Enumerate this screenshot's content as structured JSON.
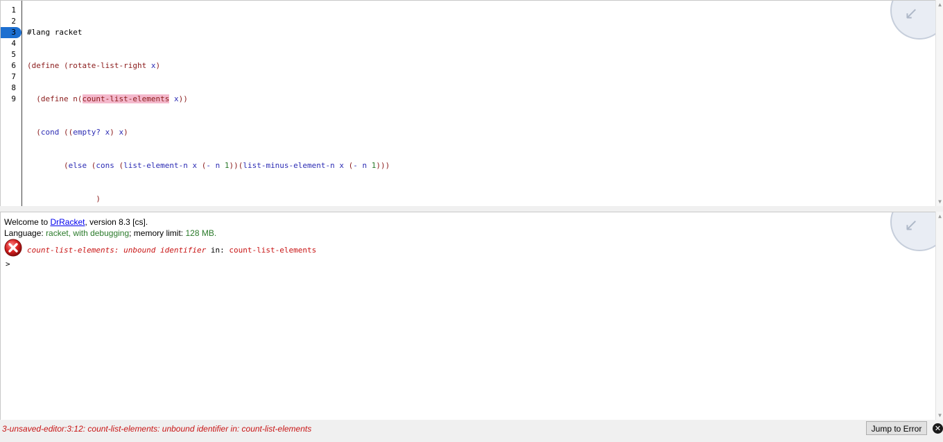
{
  "definitions": {
    "line_numbers": [
      "1",
      "2",
      "3",
      "4",
      "5",
      "6",
      "7",
      "8",
      "9"
    ],
    "current_line": "3",
    "code": {
      "l1": "#lang racket",
      "l2_open": "(",
      "l2_kw": "define",
      "l2_rest_open": " (",
      "l2_name": "rotate-list-right",
      "l2_arg": " x",
      "l2_close": ")",
      "l3_indent": "  ",
      "l3_open": "(",
      "l3_kw": "define",
      "l3_name": " n",
      "l3_p": "(",
      "l3_err": "count-list-elements",
      "l3_arg": " x",
      "l3_close": "))",
      "l4_indent": "  ",
      "l4_open": "(",
      "l4_kw": "cond",
      "l4_sp": " ",
      "l4_p1": "((",
      "l4_f": "empty?",
      "l4_arg": " x",
      "l4_p2": ")",
      "l4_val": " x",
      "l4_p3": ")",
      "l5_indent": "        ",
      "l5_p1": "(",
      "l5_else": "else",
      "l5_sp1": " ",
      "l5_p2": "(",
      "l5_cons": "cons",
      "l5_sp2": " ",
      "l5_p3": "(",
      "l5_f1": "list-element-n",
      "l5_a1": " x",
      "l5_sp3": " ",
      "l5_p4": "(",
      "l5_minus1": "-",
      "l5_n1": " n",
      "l5_one1": " 1",
      "l5_p5": "))(",
      "l5_f2": "list-minus-element-n",
      "l5_a2": " x",
      "l5_sp4": " ",
      "l5_p6": "(",
      "l5_minus2": "-",
      "l5_n2": " n",
      "l5_one2": " 1",
      "l5_p7": ")))",
      "l6": "               )",
      "l7": "        )",
      "l8": "  )"
    }
  },
  "interactions": {
    "welcome_prefix": "Welcome to ",
    "welcome_link": "DrRacket",
    "welcome_suffix": ", version 8.3 [cs].",
    "language_label": "Language: ",
    "language_value": "racket, with debugging",
    "memory_label": "; memory limit: ",
    "memory_value": "128 MB",
    "memory_end": ".",
    "error_part1": "count-list-elements: unbound identifier",
    "error_in": " in: ",
    "error_id": "count-list-elements",
    "prompt": ">"
  },
  "status_bar": {
    "message": "3-unsaved-editor:3:12: count-list-elements: unbound identifier in: count-list-elements",
    "jump_button": "Jump to Error",
    "close_glyph": "✕"
  },
  "icons": {
    "error": "error-x-icon",
    "close": "close-icon",
    "corner": "resize-arrow-icon"
  },
  "colors": {
    "error_red": "#c81414",
    "paren": "#8a1a1a",
    "keyword": "#2c2cb4",
    "literal": "#2a7a2a",
    "highlight": "#f4b8cc",
    "current_line": "#1d6fd0"
  }
}
